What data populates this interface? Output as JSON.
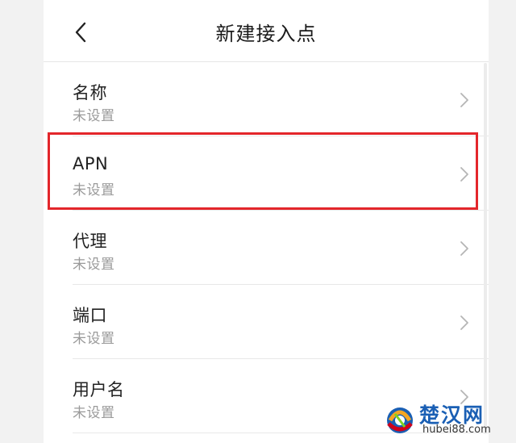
{
  "header": {
    "title": "新建接入点",
    "back_icon": "chevron-left-icon"
  },
  "rows": [
    {
      "label": "名称",
      "value": "未设置"
    },
    {
      "label": "APN",
      "value": "未设置",
      "highlighted": true
    },
    {
      "label": "代理",
      "value": "未设置"
    },
    {
      "label": "端口",
      "value": "未设置"
    },
    {
      "label": "用户名",
      "value": "未设置"
    }
  ],
  "row_icon": "chevron-right-icon",
  "colors": {
    "highlight_border": "#e3262b",
    "title_text": "#1a1a1a",
    "secondary_text": "#9a9a9a",
    "watermark_blue": "#1a5fb4"
  },
  "watermark": {
    "name": "楚汉网",
    "url": "hubei88.com"
  }
}
